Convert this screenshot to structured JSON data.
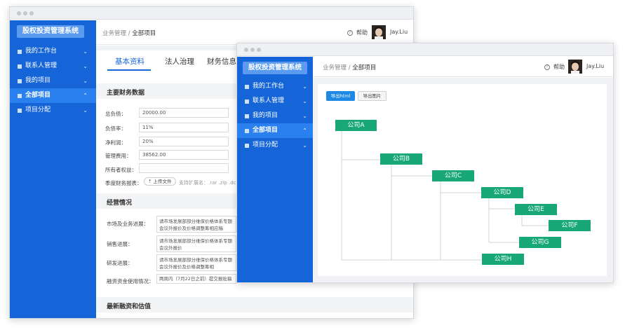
{
  "back_window": {
    "brand": "股权投资管理系统",
    "nav": [
      {
        "label": "我的工作台",
        "chev": "⌄"
      },
      {
        "label": "联系人管理",
        "chev": "⌄"
      },
      {
        "label": "我的项目",
        "chev": "⌄"
      },
      {
        "label": "全部项目",
        "chev": "⌃"
      },
      {
        "label": "项目分配",
        "chev": "⌄"
      }
    ],
    "breadcrumb": {
      "parent": "业务管理 /",
      "current": "全部项目"
    },
    "help": "帮助",
    "user": "Jay.Liu",
    "tabs": [
      "基本资料",
      "法人治理",
      "财务信息"
    ],
    "finance_section": "主要财务数据",
    "fields": [
      {
        "label": "总负债：",
        "value": "20000.00"
      },
      {
        "label": "负债率：",
        "value": "11%"
      },
      {
        "label": "净利润：",
        "value": "20%"
      },
      {
        "label": "管理费用：",
        "value": "38562.00"
      },
      {
        "label": "所有者权益：",
        "value": ""
      }
    ],
    "report_label": "季度财务报表：",
    "upload_label": "上传文件",
    "upload_hint": "支持扩展名：.rar .zip .dc",
    "ops_section": "经营情况",
    "ops_fields": [
      {
        "label": "市场及业务进展：",
        "value": "请市场发展部部分维保价格体系专题会议外报价及价格调整筹相应稿"
      },
      {
        "label": "销售进展：",
        "value": "请市场发展部部分维保价格体系专题会议外报价"
      },
      {
        "label": "研发进展：",
        "value": "请市场发展部部分维保价格体系专题会议外报价及价格调整筹相"
      },
      {
        "label": "融资资金使用情况：",
        "value": "两周内（7月22日之前）提交报批稿报"
      }
    ],
    "funding_section": "最新融资和估值"
  },
  "front_window": {
    "brand": "股权投资管理系统",
    "nav": [
      {
        "label": "我的工作台",
        "chev": "⌄"
      },
      {
        "label": "联系人管理",
        "chev": "⌄"
      },
      {
        "label": "我的项目",
        "chev": "⌄"
      },
      {
        "label": "全部项目",
        "chev": "⌃"
      },
      {
        "label": "项目分配",
        "chev": "⌄"
      }
    ],
    "breadcrumb": {
      "parent": "业务管理 /",
      "current": "全部项目"
    },
    "help": "帮助",
    "user": "Jay.Liu",
    "export_html": "导出html",
    "export_image": "导出图片",
    "nodes": [
      "公司A",
      "公司B",
      "公司C",
      "公司D",
      "公司E",
      "公司F",
      "公司G",
      "公司H"
    ]
  },
  "colors": {
    "sidebar": "#1565d8",
    "nav_active": "#2a80ee",
    "node": "#18a877",
    "primary_button": "#1e88e5"
  }
}
